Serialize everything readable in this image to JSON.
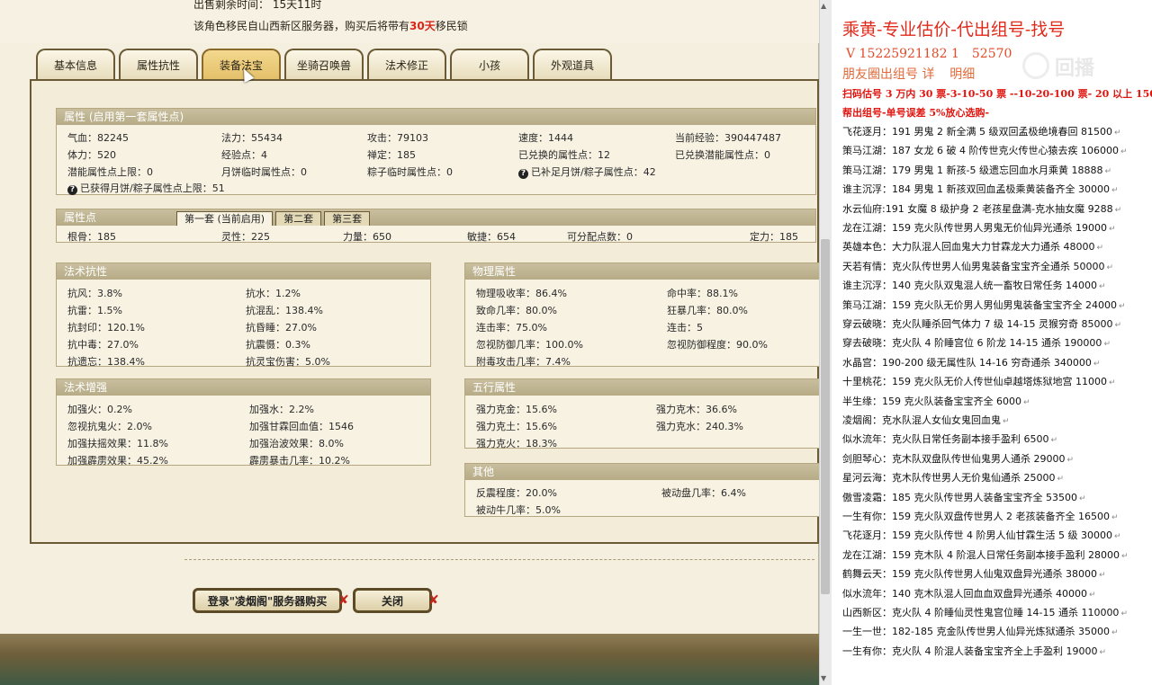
{
  "notices": {
    "line1": "出售剩余时间： 15天11时",
    "line2_pre": "该角色移民自山西新区服务器，购买后将带有",
    "line2_red": "30天",
    "line2_post": "移民锁"
  },
  "tabs": [
    "基本信息",
    "属性抗性",
    "装备法宝",
    "坐骑召唤兽",
    "法术修正",
    "小孩",
    "外观道具"
  ],
  "active_tab": "装备法宝",
  "attributes": {
    "title": "属性 (启用第一套属性点)",
    "rows": [
      [
        "气血：82245",
        "法力：55434",
        "攻击：79103",
        "速度：1444",
        "当前经验：390447487"
      ],
      [
        "体力：520",
        "经验点：4",
        "禅定：185",
        "已兑换的属性点：12",
        "已兑换潜能属性点：0"
      ],
      [
        "潜能属性点上限：0",
        "月饼临时属性点：0",
        "粽子临时属性点：0",
        "已补足月饼/粽子属性点：42",
        ""
      ]
    ],
    "footnote": "已获得月饼/粽子属性点上限：51"
  },
  "points": {
    "title": "属性点",
    "subtabs": [
      "第一套 (当前启用)",
      "第二套",
      "第三套"
    ],
    "row": [
      "根骨：185",
      "灵性：225",
      "力量：650",
      "敏捷：654",
      "可分配点数：0",
      "定力：185"
    ]
  },
  "magic_resist": {
    "title": "法术抗性",
    "rows": [
      [
        "抗风：3.8%",
        "抗水：1.2%"
      ],
      [
        "抗雷：1.5%",
        "抗混乱：138.4%"
      ],
      [
        "抗封印：120.1%",
        "抗昏睡：27.0%"
      ],
      [
        "抗中毒：27.0%",
        "抗震慑：0.3%"
      ],
      [
        "抗遗忘：138.4%",
        "抗灵宝伤害：5.0%"
      ]
    ]
  },
  "magic_boost": {
    "title": "法术增强",
    "rows": [
      [
        "加强火：0.2%",
        "加强水：2.2%"
      ],
      [
        "忽视抗鬼火：2.0%",
        "加强甘霖回血值：1546"
      ],
      [
        "加强扶摇效果：11.8%",
        "加强治波效果：8.0%"
      ],
      [
        "加强霹雳效果：45.2%",
        "霹雳暴击几率：10.2%"
      ]
    ]
  },
  "physical": {
    "title": "物理属性",
    "rows": [
      [
        "物理吸收率：86.4%",
        "命中率：88.1%"
      ],
      [
        "致命几率：80.0%",
        "狂暴几率：80.0%"
      ],
      [
        "连击率：75.0%",
        "连击：5"
      ],
      [
        "忽视防御几率：100.0%",
        "忽视防御程度：90.0%"
      ],
      [
        "附毒攻击几率：7.4%",
        ""
      ]
    ]
  },
  "five_elements": {
    "title": "五行属性",
    "rows": [
      [
        "强力克金：15.6%",
        "强力克木：36.6%"
      ],
      [
        "强力克土：15.6%",
        "强力克水：240.3%"
      ],
      [
        "强力克火：18.3%",
        ""
      ]
    ]
  },
  "other": {
    "title": "其他",
    "rows": [
      [
        "反震程度：20.0%",
        "被动盘几率：6.4%"
      ],
      [
        "被动牛几率：5.0%",
        ""
      ]
    ]
  },
  "buttons": {
    "buy": "登录\"凌烟阁\"服务器购买",
    "close": "关闭"
  },
  "notes": {
    "header": "乘黄-专业估价-代出组号-找号",
    "contact": "V 15225921182   1     52570",
    "friend": "朋友圈出组号   详      明细",
    "pricing": "扫码估号 3 万内 30 票-3-10-50 票 --10-20-100 票- 20 以上 150",
    "help": "帮出组号-单号误差 5%放心选购-",
    "watermark": "回播",
    "lines": [
      "飞花逐月：191 男鬼 2 新全满 5 级双回孟极绝境春回 81500",
      "策马江湖：187 女龙 6 破 4 阶传世克火传世心猿去疾 106000",
      "策马江湖：179 男鬼 1 新孩-5 级遗忘回血水月乘黄 18888",
      "谁主沉浮：184 男鬼 1 新孩双回血孟极乘黄装备齐全 30000",
      "水云仙府:191 女魔 8 级护身 2 老孩星盘满-克水抽女魔 9288",
      "龙在江湖：159 克火队传世男人男鬼无价仙异光通杀 19000",
      "英雄本色：大力队混人回血鬼大力甘霖龙大力通杀 48000",
      "天若有情：克火队传世男人仙男鬼装备宝宝齐全通杀 50000",
      "谁主沉浮：140 克火队双鬼混人统一畜牧日常任务 14000",
      "策马江湖：159 克火队无价男人男仙男鬼装备宝宝齐全 24000",
      "穿云破晓：克火队睡杀回气体力 7 级 14-15 灵猴穷奇 85000",
      "穿去破晓：克火队 4 阶睡宫位 6 阶龙 14-15 通杀 190000",
      "水晶宫：190-200 级无属性队 14-16 穷奇通杀 340000",
      "十里桃花：159 克火队无价人传世仙卓越塔炼狱地宫 11000",
      "半生缘：159 克火队装备宝宝齐全 6000",
      "凌烟阁：克水队混人女仙女鬼回血鬼",
      "似水流年：克火队日常任务副本接手盈利 6500",
      "剑胆琴心：克木队双盘队传世仙鬼男人通杀 29000",
      "星河云海：克木队传世男人无价鬼仙通杀 25000",
      "傲雪凌霜：185 克火队传世男人装备宝宝齐全 53500",
      "一生有你：159 克火队双盘传世男人 2 老孩装备齐全 16500",
      "飞花逐月：159 克火队传世 4 阶男人仙甘霖生活 5 级 30000",
      "龙在江湖：159 克木队 4 阶混人日常任务副本接手盈利 28000",
      "鹤舞云天：159 克火队传世男人仙鬼双盘异光通杀 38000",
      "似水流年：140 克木队混人回血血双盘异光通杀 40000",
      "山西新区：克火队 4 阶睡仙灵性鬼宫位睡 14-15 通杀 110000",
      "一生一世：182-185 克金队传世男人仙异光炼狱通杀 35000",
      "一生有你：克火队 4 阶混人装备宝宝齐全上手盈利 19000"
    ]
  }
}
